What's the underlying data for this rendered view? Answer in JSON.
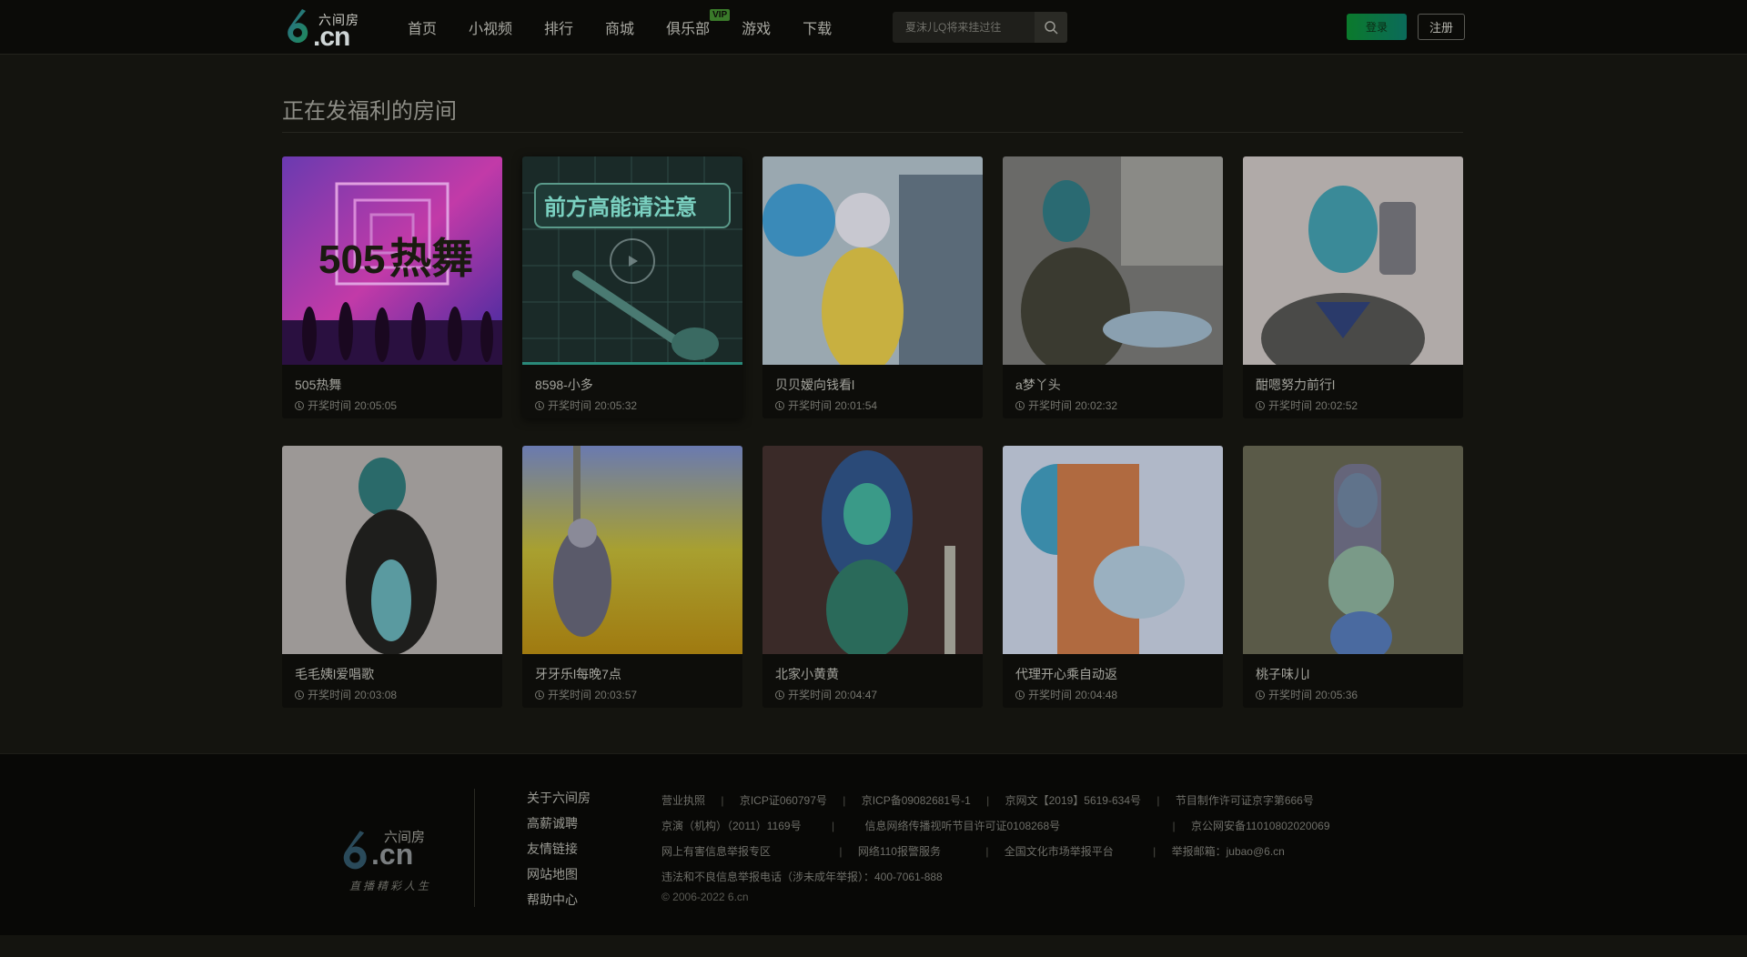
{
  "header": {
    "logo": {
      "brand": "六间房",
      "domain": ".cn"
    },
    "nav": [
      {
        "label": "首页"
      },
      {
        "label": "小视频"
      },
      {
        "label": "排行"
      },
      {
        "label": "商城"
      },
      {
        "label": "俱乐部",
        "badge": "VIP"
      },
      {
        "label": "游戏"
      },
      {
        "label": "下载"
      }
    ],
    "search": {
      "placeholder": "夏沫儿Q将来挂过往"
    },
    "login_label": "登录",
    "register_label": "注册"
  },
  "section": {
    "title": "正在发福利的房间"
  },
  "rooms": [
    {
      "name": "505热舞",
      "time": "开奖时间 20:05:05",
      "icon": "thumbnail-dance-poster"
    },
    {
      "name": "8598-小多",
      "time": "开奖时间 20:05:32",
      "icon": "thumbnail-guitar-poster",
      "poster_title": "前方高能请注意"
    },
    {
      "name": "贝贝嫒向钱看l",
      "time": "开奖时间 20:01:54",
      "icon": "thumbnail-streamer-photo"
    },
    {
      "name": "a梦丫头",
      "time": "开奖时间 20:02:32",
      "icon": "thumbnail-streamer-photo"
    },
    {
      "name": "酣嗯努力前行l",
      "time": "开奖时间 20:02:52",
      "icon": "thumbnail-streamer-photo"
    },
    {
      "name": "毛毛姨l爱唱歌",
      "time": "开奖时间 20:03:08",
      "icon": "thumbnail-streamer-photo"
    },
    {
      "name": "牙牙乐l每晚7点",
      "time": "开奖时间 20:03:57",
      "icon": "thumbnail-streamer-photo"
    },
    {
      "name": "北家小黄黄",
      "time": "开奖时间 20:04:47",
      "icon": "thumbnail-streamer-photo"
    },
    {
      "name": "代理开心乘自动返",
      "time": "开奖时间 20:04:48",
      "icon": "thumbnail-streamer-photo"
    },
    {
      "name": "桃子味儿l",
      "time": "开奖时间 20:05:36",
      "icon": "thumbnail-streamer-photo"
    }
  ],
  "footer": {
    "logo": {
      "brand": "六间房",
      "domain": ".cn",
      "slogan": "直播精彩人生"
    },
    "links": [
      "关于六间房",
      "高薪诚聘",
      "友情链接",
      "网站地图",
      "帮助中心"
    ],
    "license": {
      "row1": [
        "营业执照",
        "京ICP证060797号",
        "京ICP备09082681号-1",
        "京网文【2019】5619-634号",
        "节目制作许可证京字第666号"
      ],
      "row2": [
        "京演（机构）（2011）1169号",
        "信息网络传播视听节目许可证0108268号",
        "京公网安备11010802020069"
      ],
      "row3": [
        "网上有害信息举报专区",
        "网络110报警服务",
        "全国文化市场举报平台",
        "举报邮箱：jubao@6.cn"
      ],
      "row4": "违法和不良信息举报电话（涉未成年举报）：400-7061-888",
      "copyright": "© 2006-2022 6.cn"
    }
  }
}
